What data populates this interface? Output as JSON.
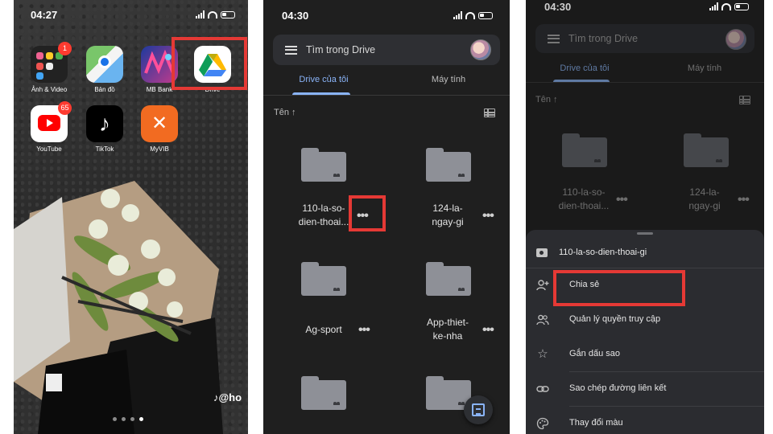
{
  "panel1": {
    "time": "04:27",
    "apps": [
      {
        "label": "Ảnh & Video",
        "badge": "1"
      },
      {
        "label": "Bản đồ",
        "badge": ""
      },
      {
        "label": "MB Bank",
        "badge": ""
      },
      {
        "label": "Drive",
        "badge": ""
      },
      {
        "label": "YouTube",
        "badge": "65"
      },
      {
        "label": "TikTok",
        "badge": ""
      },
      {
        "label": "MyVIB",
        "badge": ""
      }
    ],
    "watermark": "@ho",
    "page_dots": 4,
    "active_dot": 3
  },
  "panel2": {
    "time": "04:30",
    "search_placeholder": "Tìm trong Drive",
    "tabs": [
      "Drive của tôi",
      "Máy tính"
    ],
    "sort_label": "Tên ↑",
    "folders": [
      {
        "line1": "110-la-so-",
        "line2": "dien-thoai..."
      },
      {
        "line1": "124-la-",
        "line2": "ngay-gi"
      },
      {
        "line1": "Ag-sport",
        "line2": ""
      },
      {
        "line1": "App-thiet-",
        "line2": "ke-nha"
      },
      {
        "line1": "",
        "line2": ""
      },
      {
        "line1": "",
        "line2": ""
      }
    ],
    "more_glyph": "•••"
  },
  "panel3": {
    "time": "04:30",
    "search_placeholder": "Tìm trong Drive",
    "tabs": [
      "Drive của tôi",
      "Máy tính"
    ],
    "sort_label": "Tên ↑",
    "folders": [
      {
        "line1": "110-la-so-",
        "line2": "dien-thoai..."
      },
      {
        "line1": "124-la-",
        "line2": "ngay-gi"
      }
    ],
    "sheet": {
      "title": "110-la-so-dien-thoai-gi",
      "items": [
        {
          "label": "Chia sẻ",
          "icon": "add-person-icon"
        },
        {
          "label": "Quản lý quyền truy cập",
          "icon": "people-icon"
        },
        {
          "label": "Gắn dấu sao",
          "icon": "star-icon"
        },
        {
          "label": "Sao chép đường liên kết",
          "icon": "link-icon"
        },
        {
          "label": "Thay đổi màu",
          "icon": "palette-icon"
        }
      ]
    }
  },
  "colors": {
    "highlight": "#e53935",
    "drive_accent": "#8ab4f8",
    "drive_bg": "#1f1f1f",
    "sheet_bg": "#2b2c30"
  }
}
